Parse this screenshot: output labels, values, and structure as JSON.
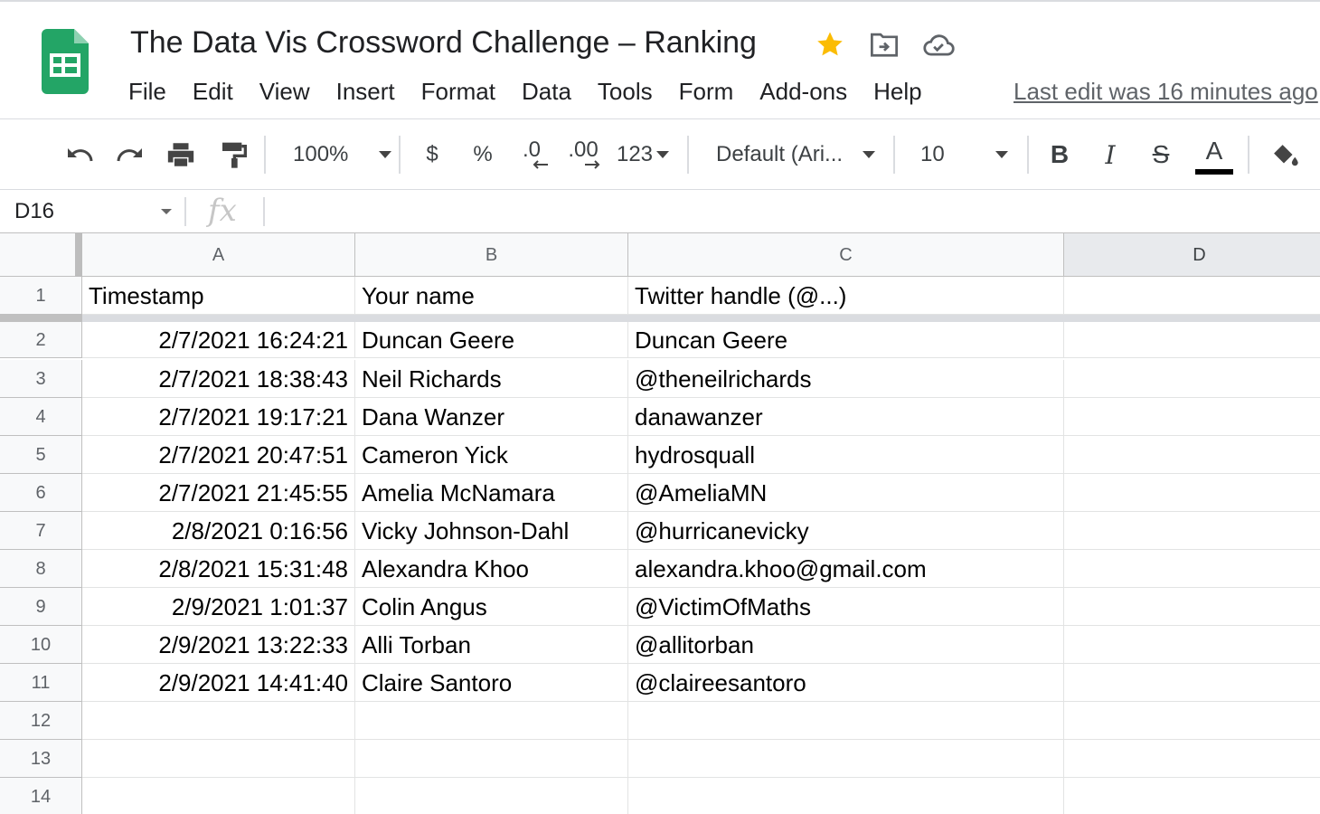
{
  "header": {
    "title": "The Data Vis Crossword Challenge – Ranking",
    "menu": [
      "File",
      "Edit",
      "View",
      "Insert",
      "Format",
      "Data",
      "Tools",
      "Form",
      "Add-ons",
      "Help"
    ],
    "last_edit": "Last edit was 16 minutes ago",
    "icons": [
      "sheets-logo-icon",
      "star-icon",
      "move-to-folder-icon",
      "cloud-saved-icon"
    ],
    "star_color": "#fbbc04",
    "logo_color": "#23a566"
  },
  "toolbar": {
    "zoom": "100%",
    "currency": "$",
    "percent": "%",
    "decrease_decimal": ".0",
    "increase_decimal": ".00",
    "more_formats": "123",
    "font": "Default (Ari...",
    "font_size": "10",
    "bold": "B",
    "italic": "I",
    "strikethrough": "S",
    "text_color": "A",
    "text_color_value": "#000000",
    "icons": [
      "undo-icon",
      "redo-icon",
      "print-icon",
      "paint-format-icon",
      "fill-color-icon"
    ]
  },
  "formula_bar": {
    "name_box": "D16",
    "fx_label": "fx",
    "value": ""
  },
  "grid": {
    "columns": [
      "A",
      "B",
      "C",
      "D"
    ],
    "selected_column": "D",
    "row_numbers": [
      "1",
      "2",
      "3",
      "4",
      "5",
      "6",
      "7",
      "8",
      "9",
      "10",
      "11",
      "12",
      "13",
      "14"
    ],
    "header_row": [
      "Timestamp",
      "Your name",
      "Twitter handle (@...)",
      ""
    ],
    "rows": [
      [
        "2/7/2021 16:24:21",
        "Duncan Geere",
        "Duncan Geere"
      ],
      [
        "2/7/2021 18:38:43",
        "Neil Richards",
        "@theneilrichards"
      ],
      [
        "2/7/2021 19:17:21",
        "Dana Wanzer",
        "danawanzer"
      ],
      [
        "2/7/2021 20:47:51",
        "Cameron Yick",
        "hydrosquall"
      ],
      [
        "2/7/2021 21:45:55",
        "Amelia McNamara",
        "@AmeliaMN"
      ],
      [
        "2/8/2021 0:16:56",
        "Vicky Johnson-Dahl",
        "@hurricanevicky"
      ],
      [
        "2/8/2021 15:31:48",
        "Alexandra Khoo",
        "alexandra.khoo@gmail.com"
      ],
      [
        "2/9/2021 1:01:37",
        "Colin Angus",
        "@VictimOfMaths"
      ],
      [
        "2/9/2021 13:22:33",
        "Alli Torban",
        "@allitorban"
      ],
      [
        "2/9/2021 14:41:40",
        "Claire Santoro",
        "@claireesantoro"
      ]
    ]
  }
}
